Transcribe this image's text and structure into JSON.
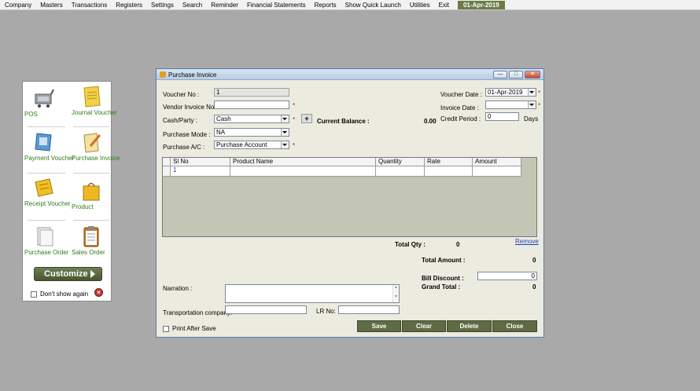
{
  "menu": {
    "items": [
      "Company",
      "Masters",
      "Transactions",
      "Registers",
      "Settings",
      "Search",
      "Reminder",
      "Financial Statements",
      "Reports",
      "Show Quick Launch",
      "Utilities",
      "Exit"
    ],
    "date": "01-Apr-2019"
  },
  "quicklaunch": {
    "tiles": [
      {
        "label": "POS",
        "icon": "pos-cart-icon"
      },
      {
        "label": "Journal Voucher",
        "icon": "journal-notepad-icon"
      },
      {
        "label": "Payment Voucher",
        "icon": "payment-voucher-icon"
      },
      {
        "label": "Purchase Invoice",
        "icon": "purchase-invoice-icon"
      },
      {
        "label": "Receipt Voucher",
        "icon": "receipt-voucher-icon"
      },
      {
        "label": "Product",
        "icon": "shopping-bag-icon"
      },
      {
        "label": "Purchase Order",
        "icon": "purchase-order-icon"
      },
      {
        "label": "Sales Order",
        "icon": "clipboard-icon"
      }
    ],
    "customize_label": "Customize",
    "dont_show_label": "Don't show again"
  },
  "dialog": {
    "title": "Purchase Invoice",
    "voucher_no_label": "Voucher No :",
    "voucher_no": "1",
    "vendor_invoice_label": "Vendor Invoice No :",
    "vendor_invoice": "",
    "cash_party_label": "Cash/Party :",
    "cash_party": "Cash",
    "plus_label": "+",
    "current_balance_label": "Current Balance :",
    "current_balance": "0.00",
    "purchase_mode_label": "Purchase Mode :",
    "purchase_mode": "NA",
    "purchase_ac_label": "Purchase A/C :",
    "purchase_ac": "Purchase Account",
    "voucher_date_label": "Voucher Date :",
    "voucher_date": "01-Apr-2019",
    "invoice_date_label": "Invoice Date :",
    "invoice_date": "",
    "credit_period_label": "Credit Period :",
    "credit_period": "0",
    "days_label": "Days",
    "required_mark": "*",
    "grid": {
      "columns": [
        "Sl No",
        "Product Name",
        "Quantity",
        "Rate",
        "Amount"
      ],
      "rows": [
        [
          "1",
          "",
          "",
          "",
          ""
        ]
      ]
    },
    "remove_label": "Remove",
    "total_qty_label": "Total Qty :",
    "total_qty": "0",
    "total_amount_label": "Total Amount :",
    "total_amount": "0",
    "bill_discount_label": "Bill Discount :",
    "bill_discount": "0",
    "grand_total_label": "Grand Total :",
    "grand_total": "0",
    "narration_label": "Narration :",
    "transport_label": "Transportation company:",
    "lr_no_label": "LR No:",
    "print_after_save_label": "Print After Save",
    "buttons": {
      "save": "Save",
      "clear": "Clear",
      "delete": "Delete",
      "close": "Close"
    }
  }
}
